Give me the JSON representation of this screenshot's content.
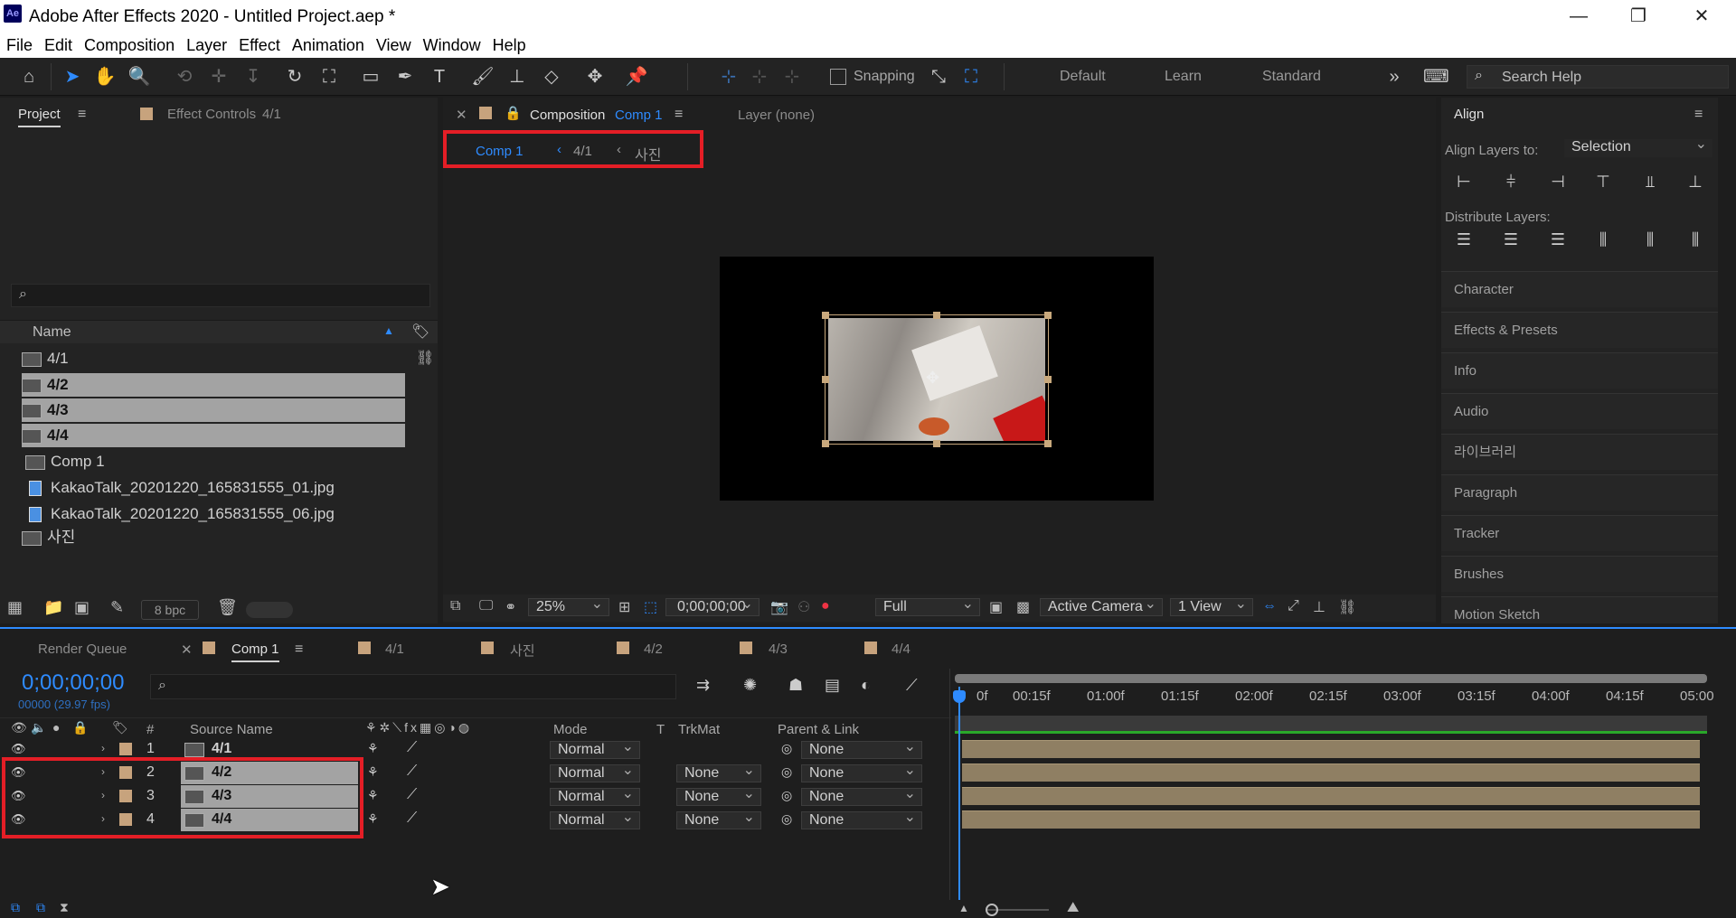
{
  "window": {
    "title": "Adobe After Effects 2020 - Untitled Project.aep *",
    "logo": "Ae"
  },
  "menu": [
    "File",
    "Edit",
    "Composition",
    "Layer",
    "Effect",
    "Animation",
    "View",
    "Window",
    "Help"
  ],
  "toolbar": {
    "snapping_label": "Snapping",
    "workspaces": [
      "Default",
      "Learn",
      "Standard"
    ],
    "search_placeholder": "Search Help"
  },
  "project_panel": {
    "tab_project": "Project",
    "tab_effect_controls": "Effect Controls",
    "effect_controls_target": "4/1",
    "column_name": "Name",
    "items": [
      {
        "name": "4/1",
        "type": "comp",
        "selected": false
      },
      {
        "name": "4/2",
        "type": "comp",
        "selected": true
      },
      {
        "name": "4/3",
        "type": "comp",
        "selected": true
      },
      {
        "name": "4/4",
        "type": "comp",
        "selected": true
      },
      {
        "name": "Comp 1",
        "type": "comp",
        "selected": false
      },
      {
        "name": "KakaoTalk_20201220_165831555_01.jpg",
        "type": "image",
        "selected": false
      },
      {
        "name": "KakaoTalk_20201220_165831555_06.jpg",
        "type": "image",
        "selected": false
      },
      {
        "name": "사진",
        "type": "comp",
        "selected": false
      }
    ],
    "bpc": "8 bpc"
  },
  "composition_panel": {
    "tab_label": "Composition",
    "tab_comp": "Comp 1",
    "layer_tab": "Layer (none)",
    "breadcrumb": [
      "Comp 1",
      "4/1",
      "사진"
    ],
    "zoom": "25%",
    "timecode": "0;00;00;00",
    "resolution": "Full",
    "camera": "Active Camera",
    "view": "1 View"
  },
  "align_panel": {
    "title": "Align",
    "align_to_label": "Align Layers to:",
    "align_to_value": "Selection",
    "distribute_label": "Distribute Layers:",
    "collapsed_panels": [
      "Character",
      "Effects & Presets",
      "Info",
      "Audio",
      "라이브러리",
      "Paragraph",
      "Tracker",
      "Brushes",
      "Motion Sketch"
    ]
  },
  "timeline": {
    "tabs": [
      "Render Queue",
      "Comp 1",
      "4/1",
      "사진",
      "4/2",
      "4/3",
      "4/4"
    ],
    "current_time": "0;00;00;00",
    "frame_info": "00000 (29.97 fps)",
    "columns": {
      "number": "#",
      "source": "Source Name",
      "mode": "Mode",
      "t": "T",
      "trkmat": "TrkMat",
      "parent": "Parent & Link"
    },
    "layers": [
      {
        "num": "1",
        "name": "4/1",
        "mode": "Normal",
        "trkmat": "",
        "parent": "None"
      },
      {
        "num": "2",
        "name": "4/2",
        "mode": "Normal",
        "trkmat": "None",
        "parent": "None"
      },
      {
        "num": "3",
        "name": "4/3",
        "mode": "Normal",
        "trkmat": "None",
        "parent": "None"
      },
      {
        "num": "4",
        "name": "4/4",
        "mode": "Normal",
        "trkmat": "None",
        "parent": "None"
      }
    ],
    "ruler": [
      "0f",
      "00:15f",
      "01:00f",
      "01:15f",
      "02:00f",
      "02:15f",
      "03:00f",
      "03:15f",
      "04:00f",
      "04:15f",
      "05:00"
    ]
  },
  "colors": {
    "accent": "#2e8bff",
    "label_sand": "#c7a37d",
    "highlight_red": "#e41e26"
  }
}
